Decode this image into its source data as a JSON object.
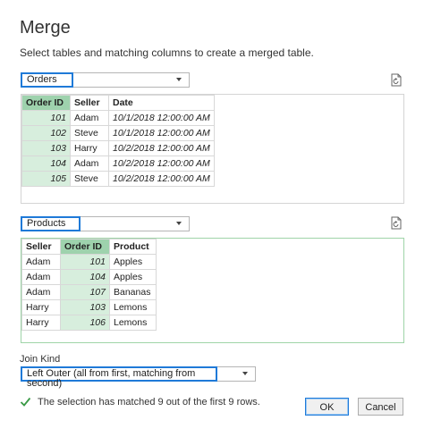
{
  "dialog": {
    "title": "Merge",
    "subtitle": "Select tables and matching columns to create a merged table."
  },
  "top_table": {
    "selected": "Orders",
    "columns": [
      "Order ID",
      "Seller",
      "Date"
    ],
    "rows": [
      [
        "101",
        "Adam",
        "10/1/2018 12:00:00 AM"
      ],
      [
        "102",
        "Steve",
        "10/1/2018 12:00:00 AM"
      ],
      [
        "103",
        "Harry",
        "10/2/2018 12:00:00 AM"
      ],
      [
        "104",
        "Adam",
        "10/2/2018 12:00:00 AM"
      ],
      [
        "105",
        "Steve",
        "10/2/2018 12:00:00 AM"
      ]
    ]
  },
  "bottom_table": {
    "selected": "Products",
    "columns": [
      "Seller",
      "Order ID",
      "Product"
    ],
    "rows": [
      [
        "Adam",
        "101",
        "Apples"
      ],
      [
        "Adam",
        "104",
        "Apples"
      ],
      [
        "Adam",
        "107",
        "Bananas"
      ],
      [
        "Harry",
        "103",
        "Lemons"
      ],
      [
        "Harry",
        "106",
        "Lemons"
      ]
    ]
  },
  "join": {
    "label": "Join Kind",
    "selected": "Left Outer (all from first, matching from second)"
  },
  "status": {
    "message": "The selection has matched 9 out of the first 9 rows.",
    "icon": "checkmark-icon",
    "color": "#3a9a46"
  },
  "buttons": {
    "ok": "OK",
    "cancel": "Cancel"
  },
  "colors": {
    "accent": "#1f7ad8",
    "selected_header": "#9ed2ad",
    "selected_cell": "#d7eedd"
  }
}
